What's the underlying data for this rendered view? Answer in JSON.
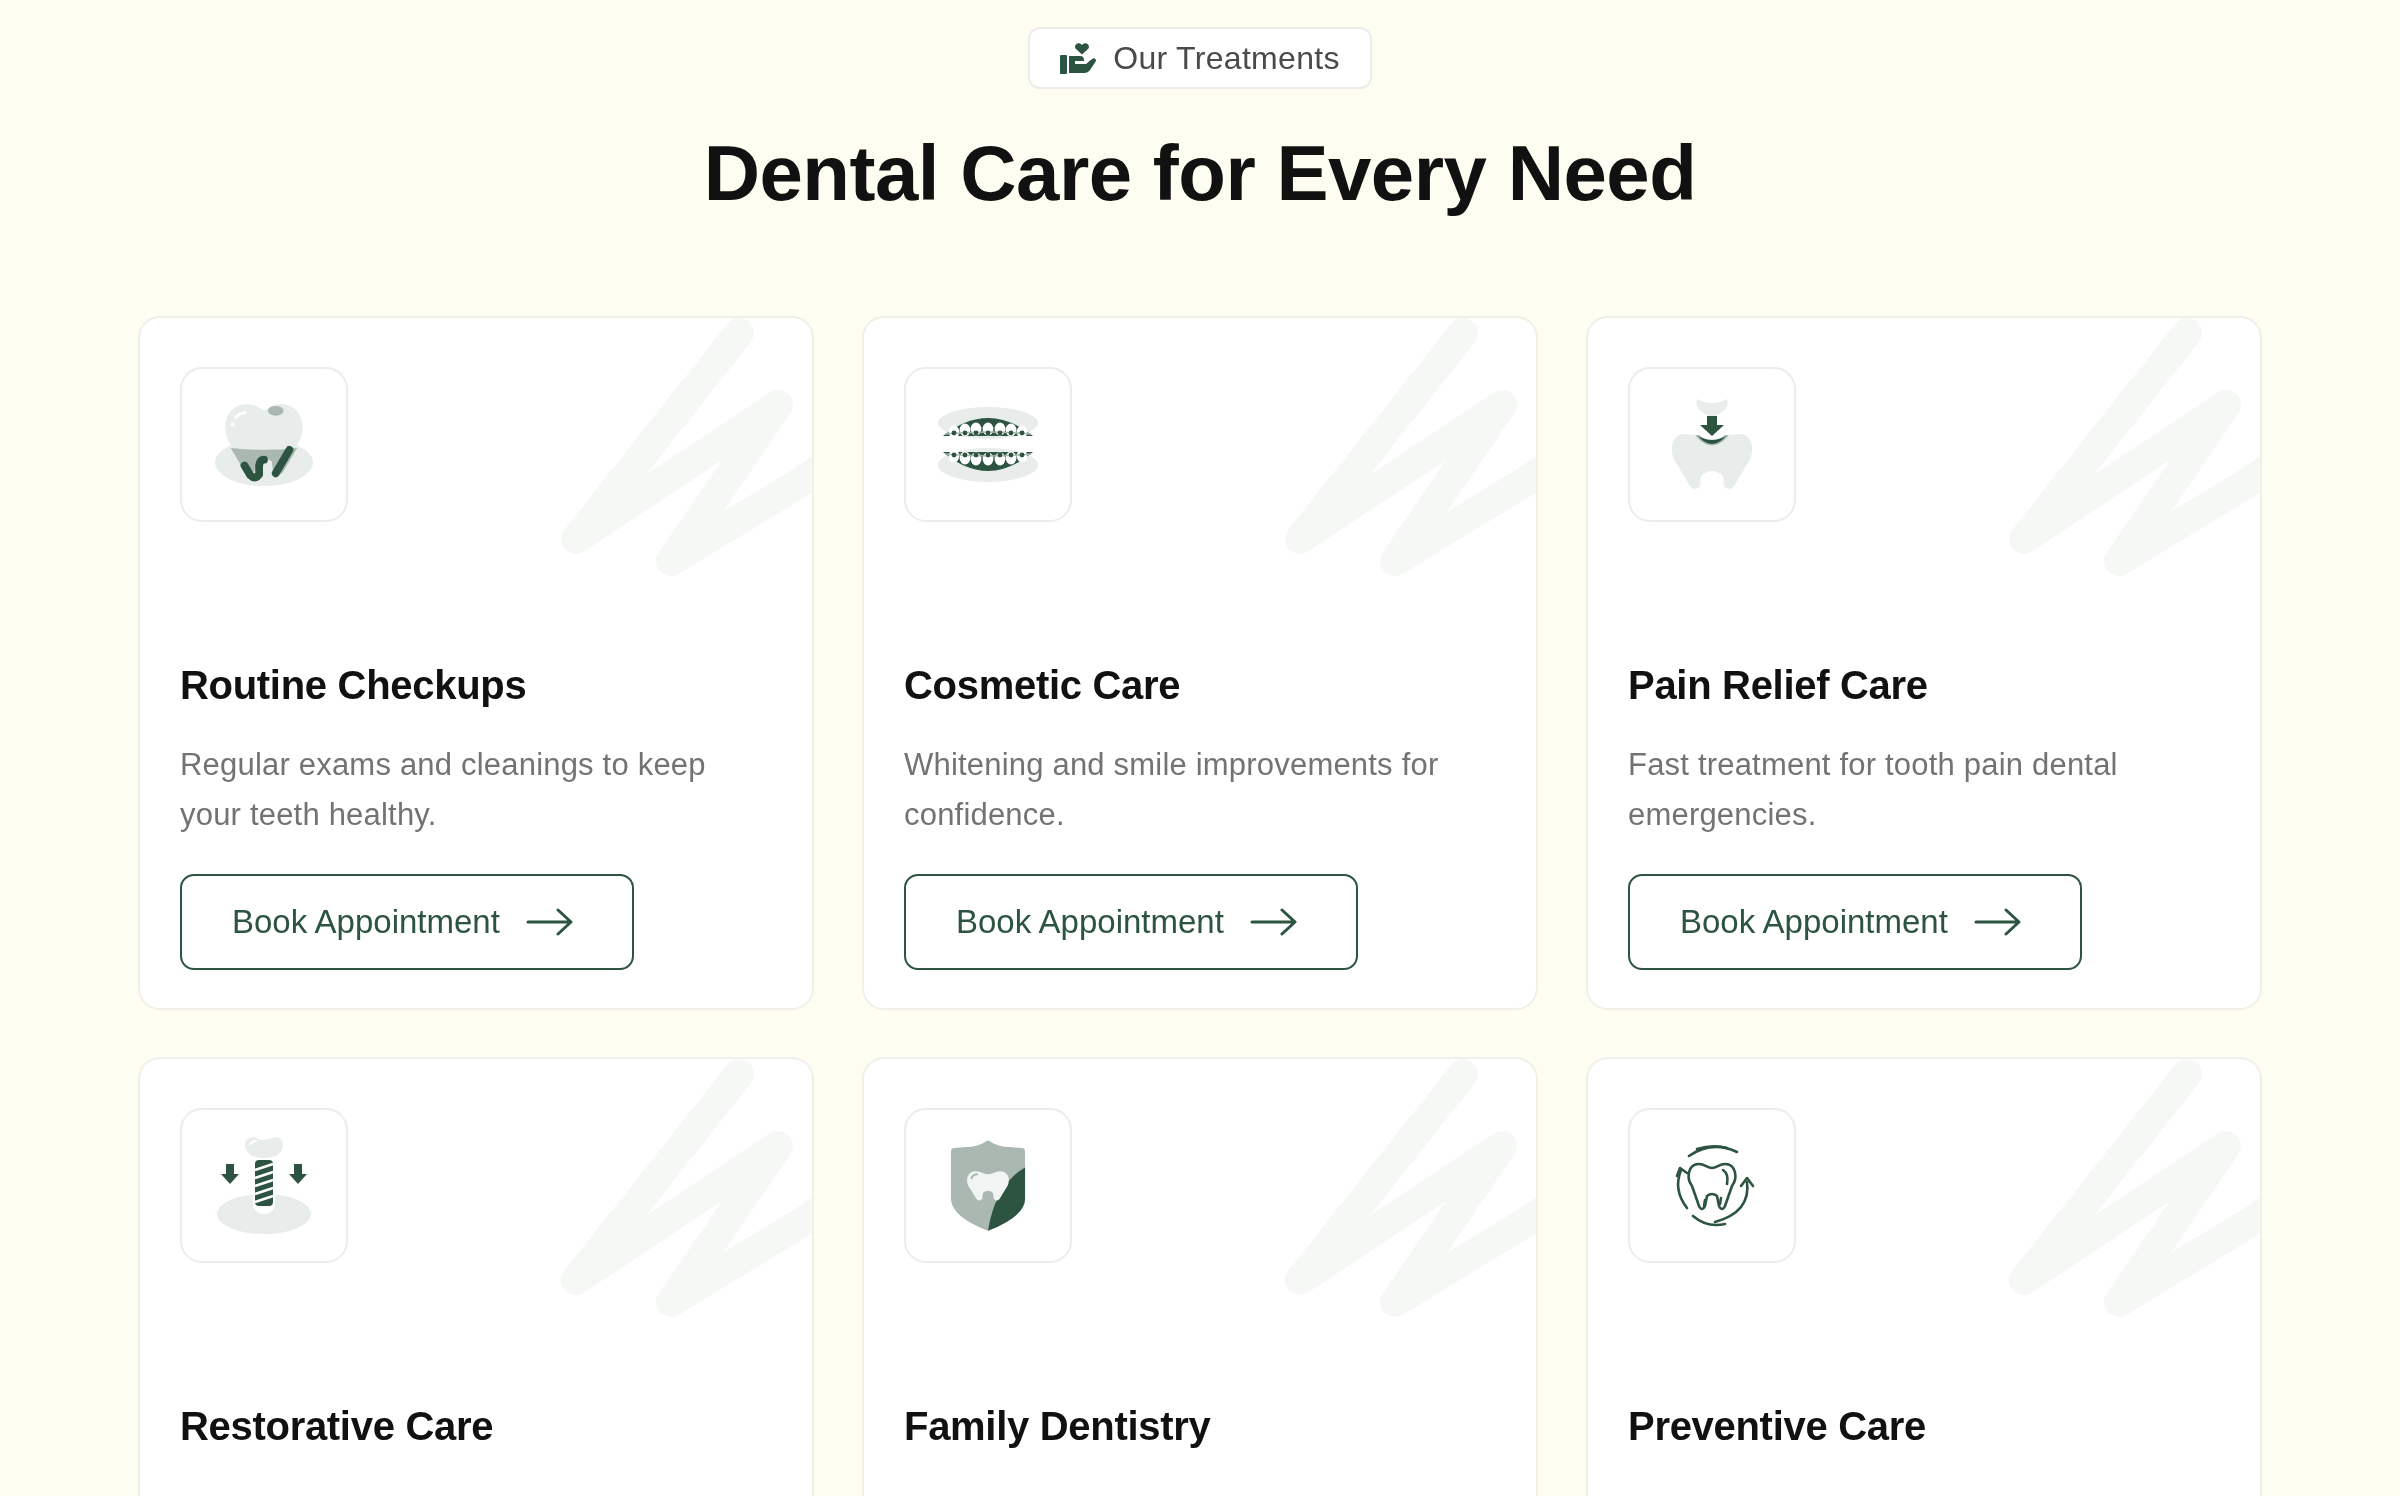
{
  "section_tag": {
    "label": "Our Treatments"
  },
  "heading": "Dental Care for Every Need",
  "treatments": [
    {
      "kind": "checkup",
      "title": "Routine Checkups",
      "description": "Regular exams and cleanings to keep your teeth healthy.",
      "button": "Book Appointment"
    },
    {
      "kind": "braces",
      "title": "Cosmetic Care",
      "description": "Whitening and smile improvements for confidence.",
      "button": "Book Appointment"
    },
    {
      "kind": "relief",
      "title": "Pain Relief Care",
      "description": "Fast treatment for tooth pain dental emergencies.",
      "button": "Book Appointment"
    },
    {
      "kind": "implant",
      "title": "Restorative Care"
    },
    {
      "kind": "shield",
      "title": "Family Dentistry"
    },
    {
      "kind": "cycle",
      "title": "Preventive Care"
    }
  ]
}
